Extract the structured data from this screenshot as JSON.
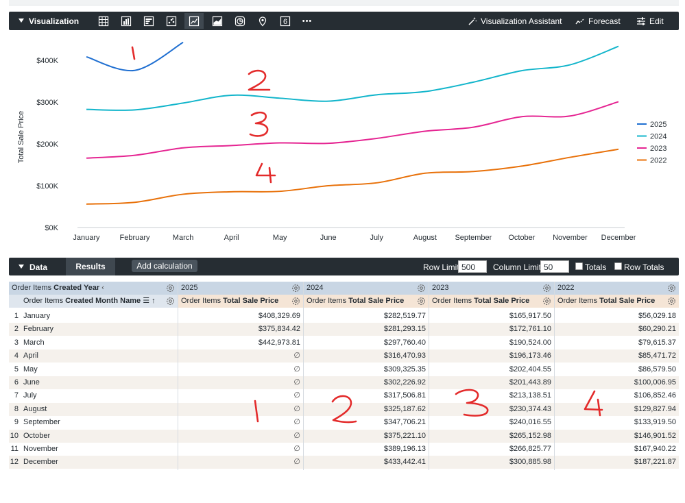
{
  "viz_bar": {
    "title": "Visualization",
    "vis_types": [
      "table-icon",
      "column-icon",
      "bar-icon",
      "scatter-icon",
      "line-icon",
      "area-icon",
      "pie-icon",
      "map-icon",
      "single-value-icon",
      "more-icon"
    ],
    "single_value_glyph": "6",
    "more_glyph": "•••",
    "assistant_label": "Visualization Assistant",
    "forecast_label": "Forecast",
    "edit_label": "Edit"
  },
  "colors": {
    "bar_bg": "#262d33",
    "series_2025": "#1f6fd1",
    "series_2024": "#12b5cb",
    "series_2023": "#e52592",
    "series_2022": "#e8710a",
    "annotation": "#e32b2b"
  },
  "chart_data": {
    "type": "line",
    "ylabel": "Total Sale Price",
    "xlabel": "",
    "ylim": [
      0,
      450000
    ],
    "ytick_labels": [
      "$0K",
      "$100K",
      "$200K",
      "$300K",
      "$400K"
    ],
    "ytick_values": [
      0,
      100000,
      200000,
      300000,
      400000
    ],
    "categories": [
      "January",
      "February",
      "March",
      "April",
      "May",
      "June",
      "July",
      "August",
      "September",
      "October",
      "November",
      "December"
    ],
    "legend_position": "right",
    "series": [
      {
        "name": "2025",
        "color": "#1f6fd1",
        "values": [
          408329.69,
          375834.42,
          442973.81,
          null,
          null,
          null,
          null,
          null,
          null,
          null,
          null,
          null
        ]
      },
      {
        "name": "2024",
        "color": "#12b5cb",
        "values": [
          282519.77,
          281293.15,
          297760.4,
          316470.93,
          309325.35,
          302226.92,
          317506.81,
          325187.62,
          347706.21,
          375221.1,
          389196.13,
          433442.41
        ]
      },
      {
        "name": "2023",
        "color": "#e52592",
        "values": [
          165917.5,
          172761.1,
          190524.0,
          196173.46,
          202404.55,
          201443.89,
          213138.51,
          230374.43,
          240016.55,
          265152.98,
          266825.77,
          300885.98
        ]
      },
      {
        "name": "2022",
        "color": "#e8710a",
        "values": [
          56029.18,
          60290.21,
          79615.37,
          85471.72,
          86579.5,
          100006.95,
          106852.46,
          129827.94,
          133919.5,
          146901.52,
          167940.22,
          187221.87
        ]
      }
    ]
  },
  "data_bar": {
    "data_label": "Data",
    "results_tab": "Results",
    "add_calculation": "Add calculation",
    "row_limit_label": "Row Limit",
    "row_limit_value": "500",
    "column_limit_label": "Column Limit",
    "column_limit_value": "50",
    "totals_label": "Totals",
    "row_totals_label": "Row Totals"
  },
  "table": {
    "pivot_header_prefix": "Order Items ",
    "pivot_header_bold": "Created Year",
    "dim_header_prefix": "Order Items ",
    "dim_header_bold": "Created Month Name",
    "measure_prefix": "Order Items ",
    "measure_bold": "Total Sale Price",
    "pivot_years": [
      "2025",
      "2024",
      "2023",
      "2022"
    ],
    "null_symbol": "∅",
    "rows": [
      {
        "n": "1",
        "month": "January",
        "v2025": "$408,329.69",
        "v2024": "$282,519.77",
        "v2023": "$165,917.50",
        "v2022": "$56,029.18"
      },
      {
        "n": "2",
        "month": "February",
        "v2025": "$375,834.42",
        "v2024": "$281,293.15",
        "v2023": "$172,761.10",
        "v2022": "$60,290.21"
      },
      {
        "n": "3",
        "month": "March",
        "v2025": "$442,973.81",
        "v2024": "$297,760.40",
        "v2023": "$190,524.00",
        "v2022": "$79,615.37"
      },
      {
        "n": "4",
        "month": "April",
        "v2025": null,
        "v2024": "$316,470.93",
        "v2023": "$196,173.46",
        "v2022": "$85,471.72"
      },
      {
        "n": "5",
        "month": "May",
        "v2025": null,
        "v2024": "$309,325.35",
        "v2023": "$202,404.55",
        "v2022": "$86,579.50"
      },
      {
        "n": "6",
        "month": "June",
        "v2025": null,
        "v2024": "$302,226.92",
        "v2023": "$201,443.89",
        "v2022": "$100,006.95"
      },
      {
        "n": "7",
        "month": "July",
        "v2025": null,
        "v2024": "$317,506.81",
        "v2023": "$213,138.51",
        "v2022": "$106,852.46"
      },
      {
        "n": "8",
        "month": "August",
        "v2025": null,
        "v2024": "$325,187.62",
        "v2023": "$230,374.43",
        "v2022": "$129,827.94"
      },
      {
        "n": "9",
        "month": "September",
        "v2025": null,
        "v2024": "$347,706.21",
        "v2023": "$240,016.55",
        "v2022": "$133,919.50"
      },
      {
        "n": "10",
        "month": "October",
        "v2025": null,
        "v2024": "$375,221.10",
        "v2023": "$265,152.98",
        "v2022": "$146,901.52"
      },
      {
        "n": "11",
        "month": "November",
        "v2025": null,
        "v2024": "$389,196.13",
        "v2023": "$266,825.77",
        "v2022": "$167,940.22"
      },
      {
        "n": "12",
        "month": "December",
        "v2025": null,
        "v2024": "$433,442.41",
        "v2023": "$300,885.98",
        "v2022": "$187,221.87"
      }
    ]
  },
  "annotations": {
    "chart_labels": [
      "1",
      "2",
      "3",
      "4"
    ],
    "table_labels": [
      "1",
      "2",
      "3",
      "4"
    ]
  }
}
